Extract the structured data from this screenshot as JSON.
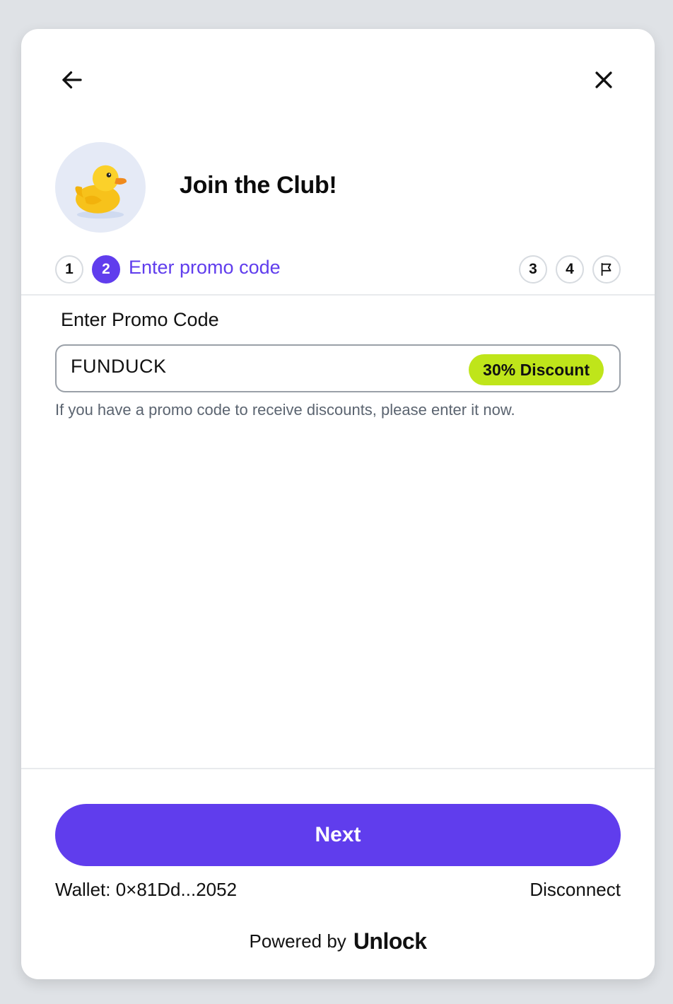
{
  "header": {
    "back_icon": "arrow-left-icon",
    "close_icon": "close-icon",
    "title": "Join the Club!",
    "avatar_icon": "duck-icon"
  },
  "steps": {
    "items": [
      {
        "number": "1",
        "state": "done"
      },
      {
        "number": "2",
        "state": "active",
        "label": "Enter promo code"
      },
      {
        "number": "3",
        "state": "upcoming"
      },
      {
        "number": "4",
        "state": "upcoming"
      }
    ],
    "final_icon": "flag-icon",
    "active_color": "#603ded"
  },
  "promo": {
    "label": "Enter Promo Code",
    "value": "FUNDUCK",
    "badge": "30% Discount",
    "badge_color": "#bfe51a",
    "help": "If you have a promo code to receive discounts, please enter it now."
  },
  "footer": {
    "next_label": "Next",
    "next_color": "#603ded",
    "wallet": "Wallet: 0×81Dd...2052",
    "disconnect": "Disconnect",
    "powered_by": "Powered by",
    "brand": "Unlock"
  }
}
